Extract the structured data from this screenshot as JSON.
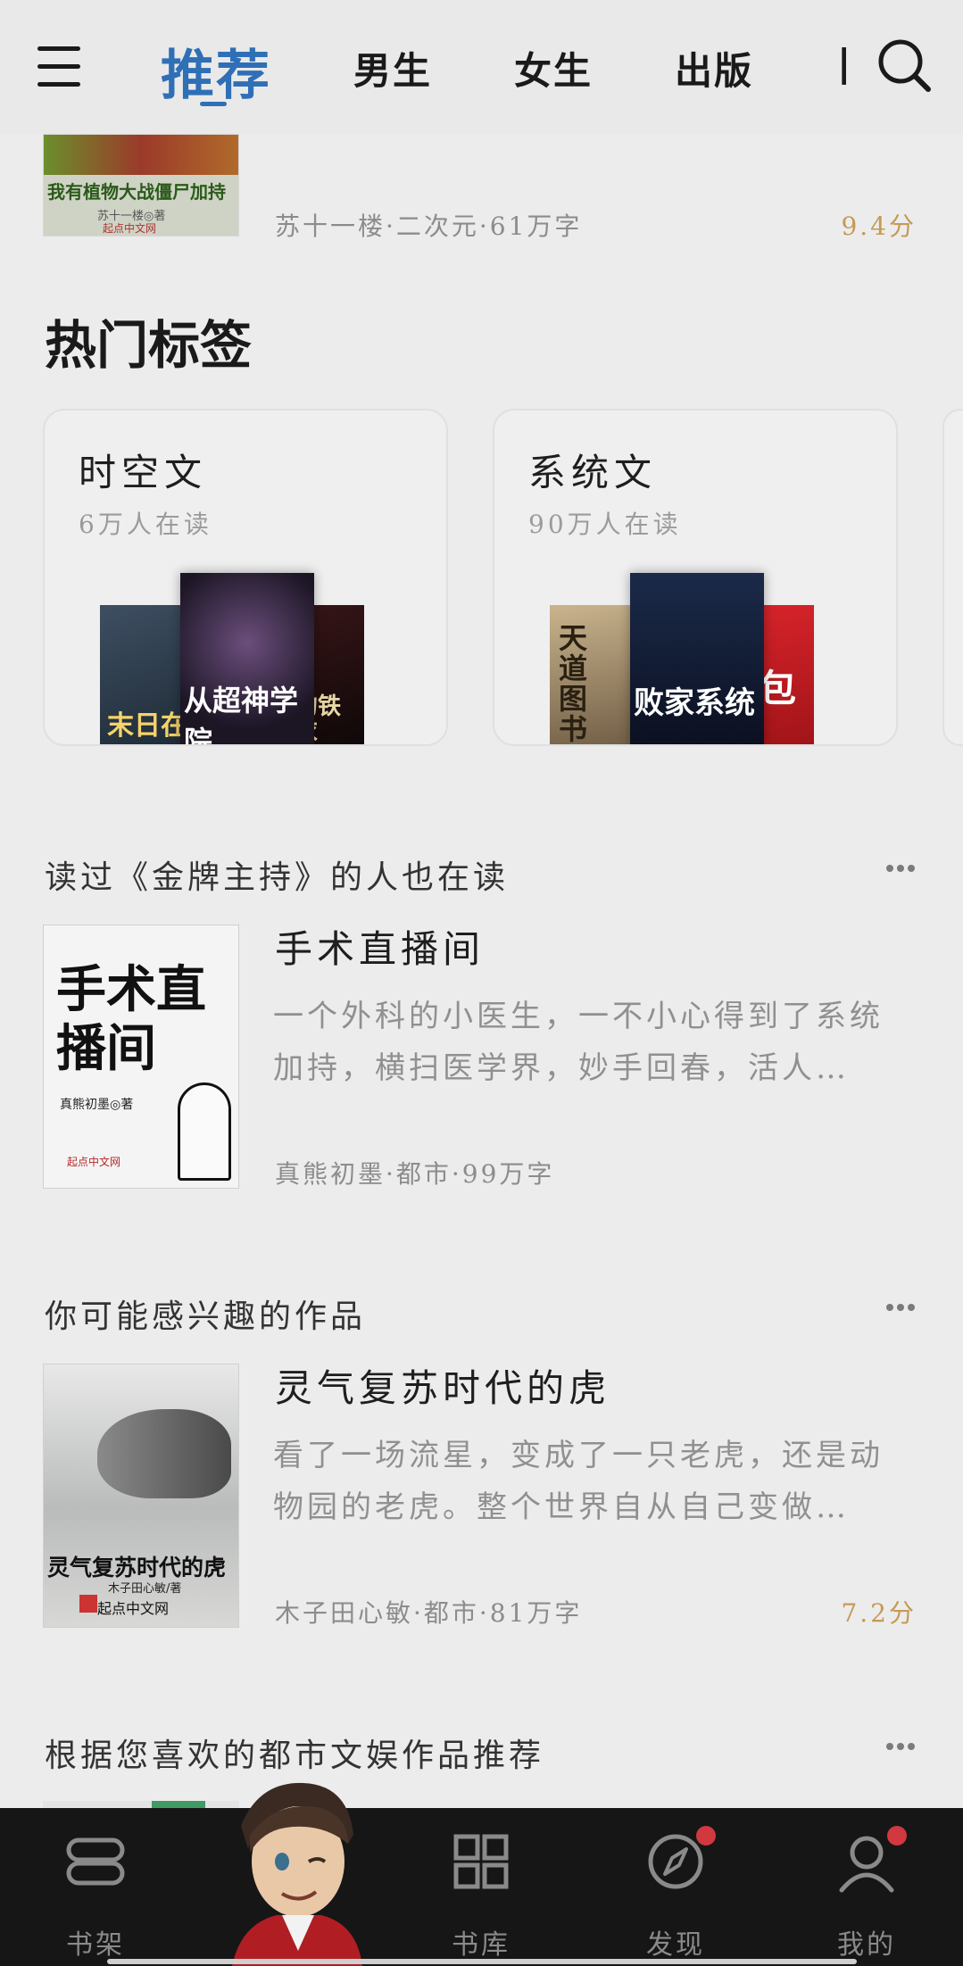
{
  "nav": {
    "tabs": [
      {
        "label": "推荐",
        "active": true
      },
      {
        "label": "男生"
      },
      {
        "label": "女生"
      },
      {
        "label": "出版"
      }
    ]
  },
  "top_book": {
    "cover_title": "我有植物大战僵尸加持",
    "cover_author": "苏十一楼◎著",
    "cover_publisher": "起点中文网",
    "meta": "苏十一楼·二次元·61万字",
    "score": "9.4分"
  },
  "hot_tags": {
    "title": "热门标签",
    "cards": [
      {
        "name": "时空文",
        "count": "6万人在读",
        "covers": [
          "末日在",
          "从超神学院",
          "我的铁战衣"
        ]
      },
      {
        "name": "系统文",
        "count": "90万人在读",
        "covers": [
          "天道图书馆",
          "败家系统",
          "红包群"
        ]
      }
    ]
  },
  "sections": [
    {
      "title": "读过《金牌主持》的人也在读",
      "book": {
        "title": "手术直播间",
        "cover_text": "手术直播间",
        "cover_author": "真熊初墨◎著",
        "cover_publisher": "起点中文网",
        "desc": "一个外科的小医生，一不小心得到了系统加持，横扫医学界，妙手回春，活人…",
        "meta": "真熊初墨·都市·99万字"
      }
    },
    {
      "title": "你可能感兴趣的作品",
      "book": {
        "title": "灵气复苏时代的虎",
        "cover_text": "灵气复苏时代的虎",
        "cover_author": "木子田心敏/著",
        "cover_publisher": "起点中文网",
        "desc": "看了一场流星，变成了一只老虎，还是动物园的老虎。整个世界自从自己变做…",
        "meta": "木子田心敏·都市·81万字",
        "score": "7.2分"
      }
    },
    {
      "title": "根据您喜欢的都市文娱作品推荐"
    }
  ],
  "bottom_nav": {
    "items": [
      {
        "label": "书架",
        "icon": "bookshelf-icon"
      },
      {
        "label": "",
        "icon": "mascot-avatar"
      },
      {
        "label": "书库",
        "icon": "library-grid-icon"
      },
      {
        "label": "发现",
        "icon": "compass-icon",
        "badge": true
      },
      {
        "label": "我的",
        "icon": "profile-icon",
        "badge": true
      }
    ]
  },
  "colors": {
    "accent": "#2f6fb6",
    "score": "#c59a55",
    "badge": "#d2383f",
    "bottom_bar": "#161616"
  }
}
